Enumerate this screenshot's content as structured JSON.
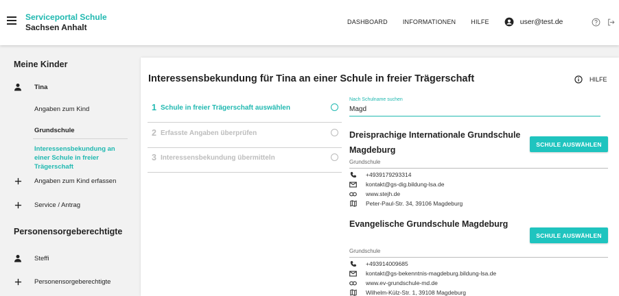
{
  "header": {
    "brand_title": "Serviceportal Schule",
    "brand_subtitle": "Sachsen Anhalt",
    "nav": [
      "DASHBOARD",
      "INFORMATIONEN",
      "HILFE"
    ],
    "user": "user@test.de"
  },
  "sidebar": {
    "kids_heading": "Meine Kinder",
    "child_name": "Tina",
    "child_items": [
      "Angaben zum Kind",
      "Grundschule"
    ],
    "active_item": "Interessensbekundung an einer Schule in freier Trägerschaft",
    "add_child": "Angaben zum Kind erfassen",
    "service": "Service / Antrag",
    "guardians_heading": "Personensorgeberechtigte",
    "guardian_name": "Steffi",
    "guardians_item": "Personensorgeberechtigte"
  },
  "main": {
    "title": "Interessensbekundung für Tina an einer Schule in freier Trägerschaft",
    "help": "HILFE",
    "steps": [
      {
        "num": "1",
        "label": "Schule in freier Trägerschaft auswählen"
      },
      {
        "num": "2",
        "label": "Erfasste Angaben überprüfen"
      },
      {
        "num": "3",
        "label": "Interessensbekundung übermitteln"
      }
    ],
    "search": {
      "label": "Nach Schulname suchen",
      "value": "Magd"
    },
    "select_label": "SCHULE AUSWÄHLEN",
    "schools": [
      {
        "name": "Dreisprachige Internationale Grundschule Magdeburg",
        "type": "Grundschule",
        "phone": "+4939179293314",
        "email": "kontakt@gs-dig.bildung-lsa.de",
        "web": "www.stejh.de",
        "address": "Peter-Paul-Str. 34, 39106 Magdeburg"
      },
      {
        "name": "Evangelische Grundschule Magdeburg",
        "type": "Grundschule",
        "phone": "+493914009685",
        "email": "kontakt@gs-bekenntnis-magdeburg.bildung-lsa.de",
        "web": "www.ev-grundschule-md.de",
        "address": "Wilhelm-Külz-Str. 1, 39108 Magdeburg"
      }
    ]
  },
  "colors": {
    "accent": "#1fb8b0",
    "button": "#1fc4bf",
    "muted": "#bdbdbd"
  },
  "icons": [
    "menu-icon",
    "user-icon",
    "help-circle-icon",
    "logout-icon",
    "person-icon",
    "plus-icon",
    "info-icon",
    "phone-icon",
    "mail-icon",
    "link-icon",
    "map-icon"
  ]
}
